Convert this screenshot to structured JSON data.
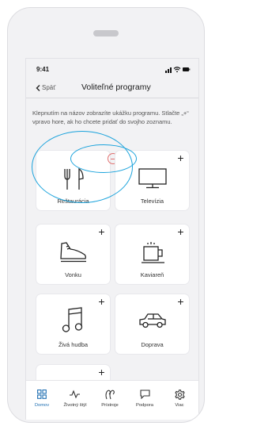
{
  "status_bar": {
    "time": "9:41"
  },
  "nav": {
    "back_label": "Späť",
    "title": "Voliteľné programy"
  },
  "instructions": "Klepnutím na názov zobrazíte ukážku programu. Stlačte „+“ vpravo hore, ak ho chcete pridať do svojho zoznamu.",
  "programs": [
    {
      "label": "Reštaurácia",
      "icon": "cutlery-icon"
    },
    {
      "label": "Televízia",
      "icon": "television-icon"
    },
    {
      "label": "Vonku",
      "icon": "shoe-icon"
    },
    {
      "label": "Kaviareň",
      "icon": "coffee-cup-icon"
    },
    {
      "label": "Živá hudba",
      "icon": "music-note-icon"
    },
    {
      "label": "Doprava",
      "icon": "car-icon"
    }
  ],
  "add_symbol": "+",
  "tabs": [
    {
      "label": "Domov",
      "icon": "grid-icon",
      "active": true
    },
    {
      "label": "Životný štýl",
      "icon": "activity-icon",
      "active": false
    },
    {
      "label": "Prístroje",
      "icon": "hearing-aids-icon",
      "active": false
    },
    {
      "label": "Podpora",
      "icon": "chat-bubble-icon",
      "active": false
    },
    {
      "label": "Viac",
      "icon": "gear-icon",
      "active": false
    }
  ],
  "colors": {
    "accent": "#1f6fb2",
    "annotation": "#1ba3dc",
    "remove": "#e0706f",
    "background": "#f2f2f4"
  }
}
